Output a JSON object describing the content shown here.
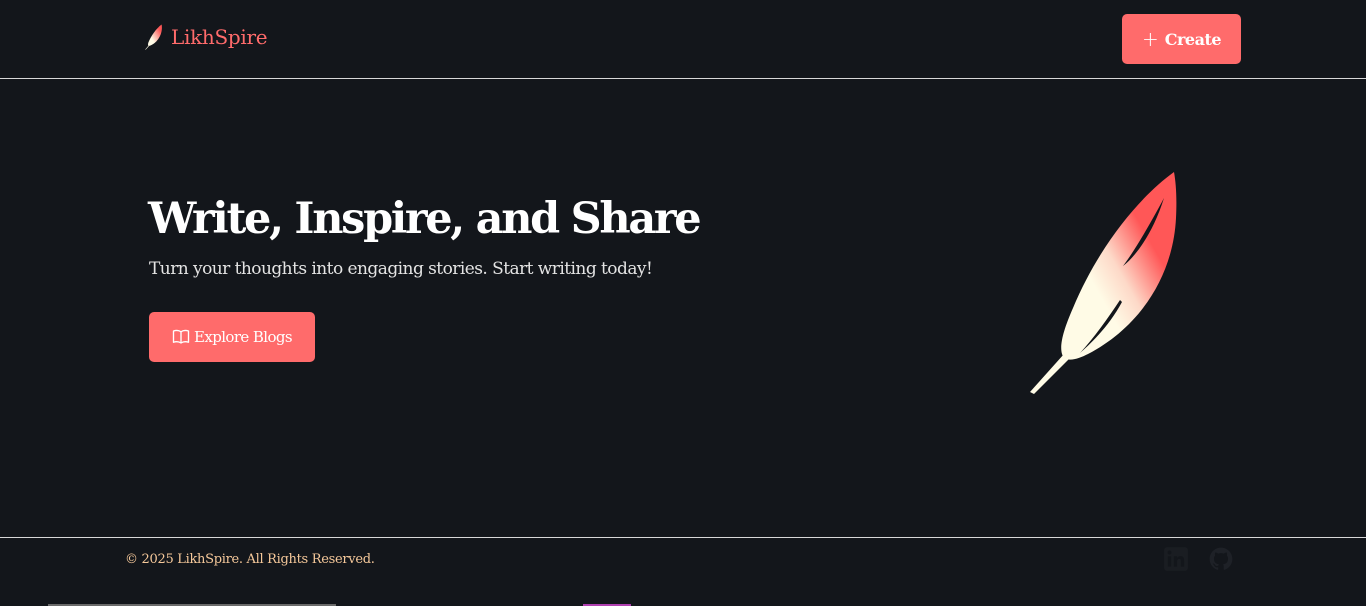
{
  "header": {
    "brand_name": "LikhSpire",
    "create_label": "Create",
    "brand_icon": "feather-icon",
    "create_icon": "plus-icon"
  },
  "hero": {
    "title": "Write, Inspire, and Share",
    "subtitle": "Turn your thoughts into engaging stories. Start writing today!",
    "explore_label": "Explore Blogs",
    "explore_icon": "book-open-icon",
    "illustration": "feather-icon"
  },
  "footer": {
    "copyright": "© 2025 LikhSpire. All Rights Reserved.",
    "social_icons": [
      "linkedin-icon",
      "github-icon"
    ]
  },
  "colors": {
    "background": "#13161b",
    "accent": "#ff6b6b",
    "footer_text": "#f5c89a",
    "text": "#ffffff"
  }
}
